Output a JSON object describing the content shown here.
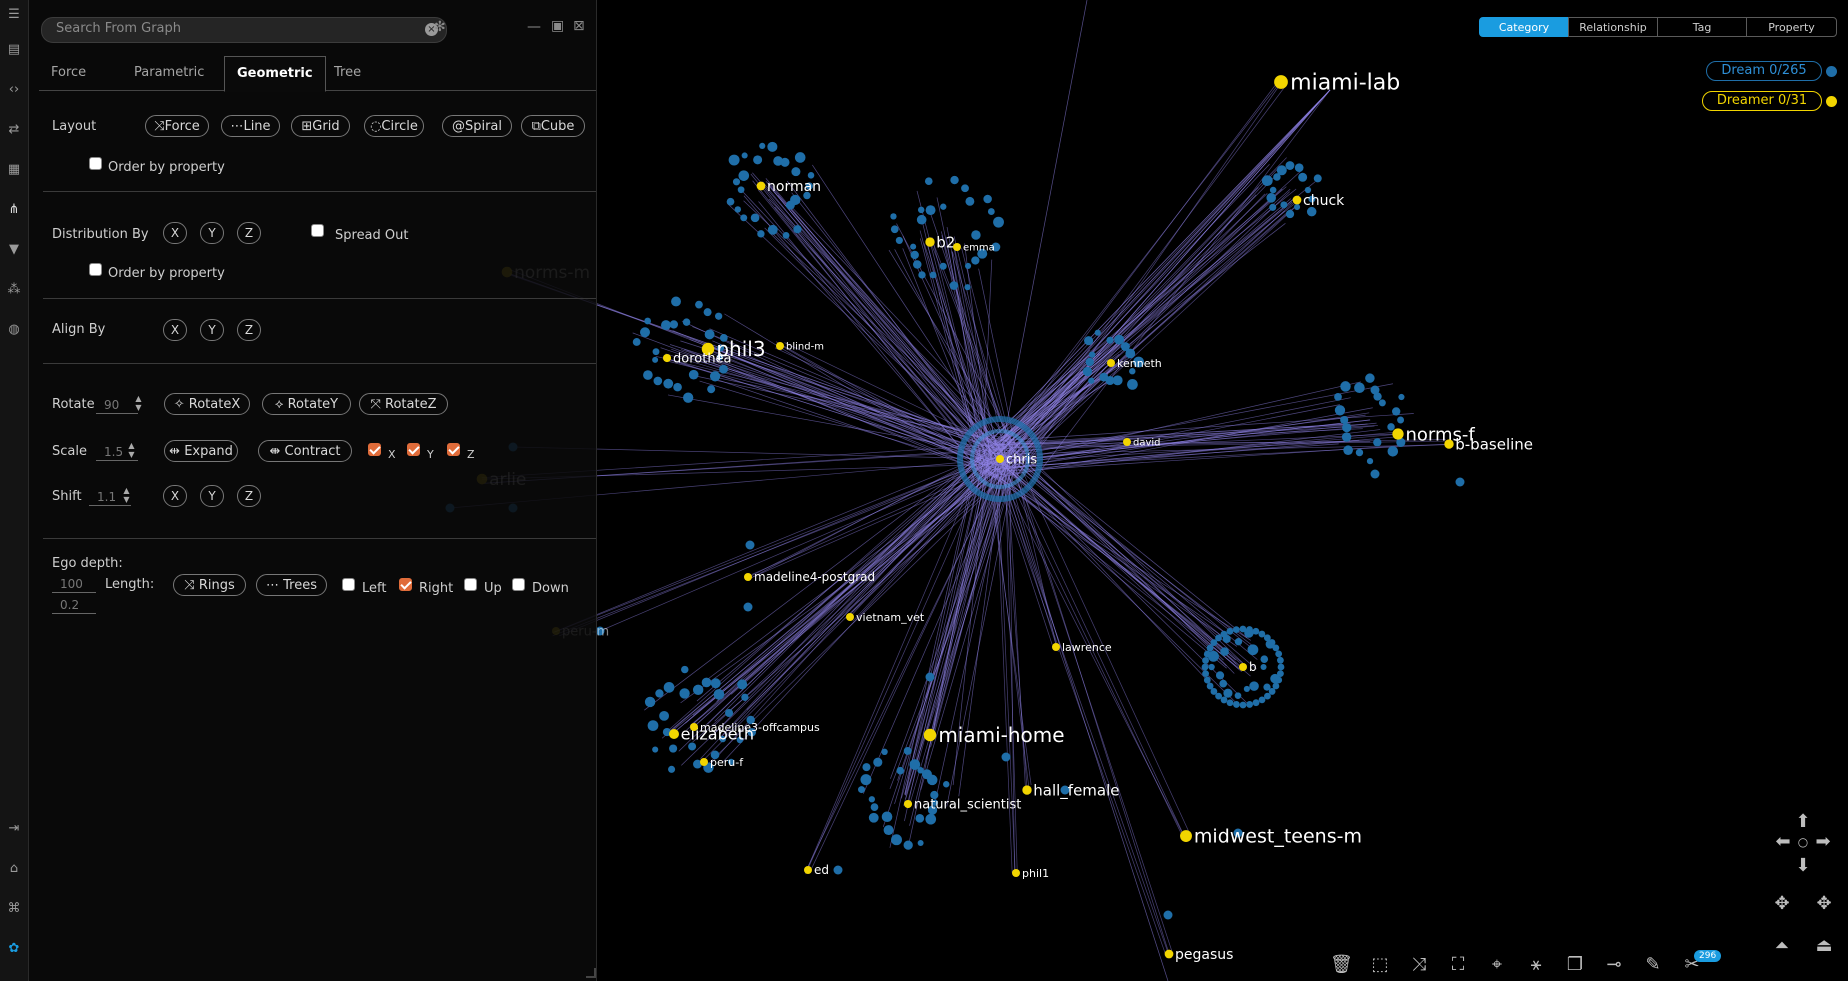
{
  "colors": {
    "node": "#1f6ea8",
    "node_yellow": "#f2d500",
    "edge": "#8f82e6",
    "accent": "#1a9ce0",
    "checked": "#e06c3a"
  },
  "search": {
    "placeholder": "Search From Graph"
  },
  "rail_icons": [
    "menu-icon",
    "file-icon",
    "code-icon",
    "swap-icon",
    "table-icon",
    "hierarchy-icon",
    "filter-icon",
    "network-icon",
    "globe-icon",
    "logout-icon",
    "home-icon",
    "command-icon",
    "brand-icon"
  ],
  "tabs": [
    "Force",
    "Parametric",
    "Geometric",
    "Tree"
  ],
  "active_tab": "Geometric",
  "layout": {
    "label": "Layout",
    "buttons": [
      "Force",
      "Line",
      "Grid",
      "Circle",
      "Spiral",
      "Cube"
    ],
    "order_label": "Order by property"
  },
  "distribution": {
    "label": "Distribution By",
    "axes": [
      "X",
      "Y",
      "Z"
    ],
    "spread_label": "Spread Out",
    "order_label": "Order by property"
  },
  "align": {
    "label": "Align By",
    "axes": [
      "X",
      "Y",
      "Z"
    ]
  },
  "rotate": {
    "label": "Rotate",
    "value": "90",
    "buttons": [
      "RotateX",
      "RotateY",
      "RotateZ"
    ]
  },
  "scale": {
    "label": "Scale",
    "value": "1.5",
    "buttons": [
      "Expand",
      "Contract"
    ],
    "axes": [
      "X",
      "Y",
      "Z"
    ]
  },
  "shift": {
    "label": "Shift",
    "value": "1.1",
    "axes": [
      "X",
      "Y",
      "Z"
    ]
  },
  "ego": {
    "depth_label": "Ego depth:",
    "depth_value": "100",
    "length_label": "Length:",
    "length_value": "0.2",
    "buttons": [
      "Rings",
      "Trees"
    ],
    "directions": [
      "Left",
      "Right",
      "Up",
      "Down"
    ]
  },
  "view_tabs": [
    "Category",
    "Relationship",
    "Tag",
    "Property"
  ],
  "active_view_tab": "Category",
  "legend": [
    {
      "label": "Dream 0/265",
      "color": "#1f6ea8"
    },
    {
      "label": "Dreamer 0/31",
      "color": "#f2d500"
    }
  ],
  "badge": "296",
  "graph": {
    "nodes": [
      "miami-lab",
      "chuck",
      "norman",
      "b2",
      "emma",
      "phil3",
      "dorothea",
      "blind-m",
      "kenneth",
      "norms-m",
      "chris",
      "david",
      "norms-f",
      "b-baseline",
      "arlie",
      "madeline4-postgrad",
      "vietnam_vet",
      "lawrence",
      "b",
      "elizabeth",
      "madeline3-offcampus",
      "peru-f",
      "miami-home",
      "hall_female",
      "natural_scientist",
      "midwest_teens-m",
      "ed",
      "phil1",
      "peru-m",
      "pegasus"
    ]
  }
}
